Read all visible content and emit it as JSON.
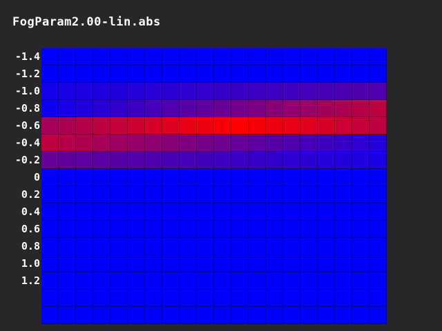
{
  "title": "FogParam2.00-lin.abs",
  "chart_data": {
    "type": "heatmap",
    "rows": 16,
    "cols": 20,
    "row_labels": [
      "-1.4",
      "-1.2",
      "-1.0",
      "-0.8",
      "-0.6",
      "-0.4",
      "-0.2",
      "0",
      "0.2",
      "0.4",
      "0.6",
      "0.8",
      "1.0",
      "1.2",
      "",
      ""
    ],
    "colors": {
      "low": "#0000ff",
      "high": "#ff0000"
    },
    "row_profile": [
      0,
      0,
      0.2,
      0.4,
      0.75,
      0.45,
      0.25,
      0,
      0,
      0,
      0,
      0,
      0,
      0,
      0,
      0
    ],
    "row_slope": [
      0,
      0,
      0.12,
      0.35,
      0,
      -0.3,
      -0.15,
      0,
      0,
      0,
      0,
      0,
      0,
      0,
      0,
      0
    ]
  }
}
